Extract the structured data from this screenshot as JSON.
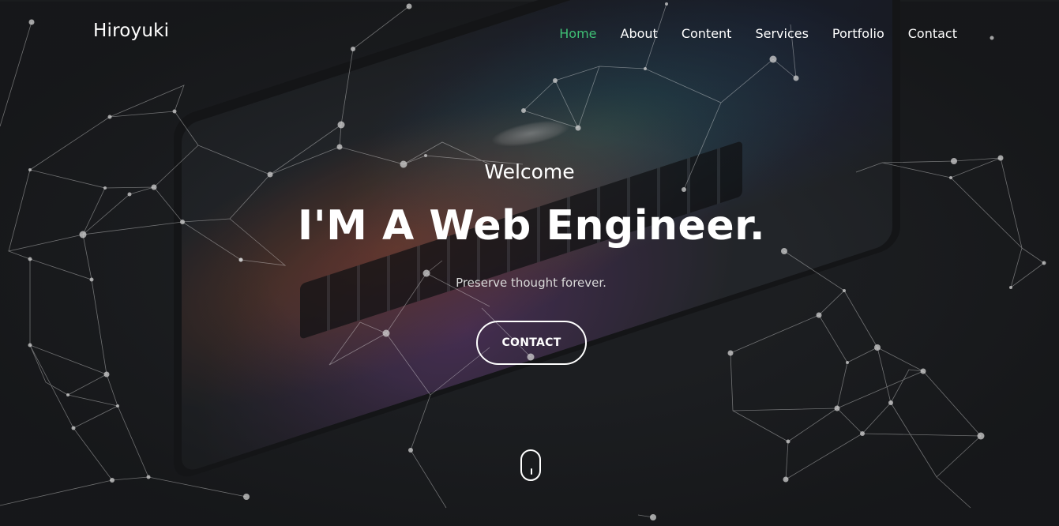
{
  "brand": "Hiroyuki",
  "nav": {
    "items": [
      {
        "label": "Home",
        "active": true
      },
      {
        "label": "About",
        "active": false
      },
      {
        "label": "Content",
        "active": false
      },
      {
        "label": "Services",
        "active": false
      },
      {
        "label": "Portfolio",
        "active": false
      },
      {
        "label": "Contact",
        "active": false
      }
    ]
  },
  "hero": {
    "welcome": "Welcome",
    "headline": "I'M A Web Engineer.",
    "tagline": "Preserve thought forever.",
    "cta_label": "CONTACT"
  },
  "icons": {
    "scroll": "mouse-scroll-icon",
    "background": "particle-network"
  },
  "colors": {
    "background": "#1c1e21",
    "accent": "#3fbf75",
    "text": "#ffffff"
  }
}
